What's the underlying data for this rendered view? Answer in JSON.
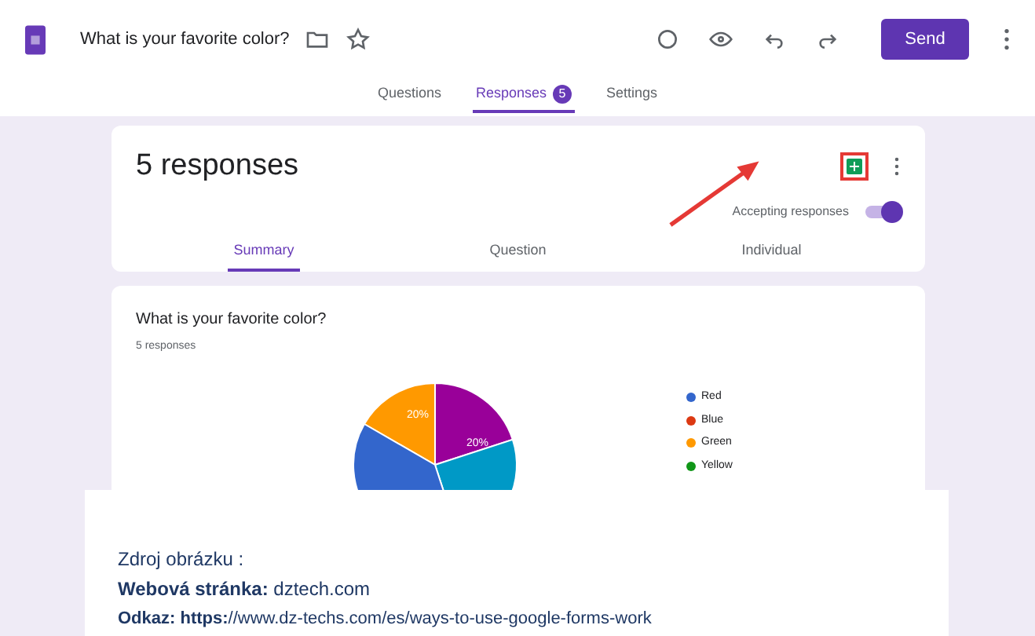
{
  "window": {
    "title": "What is your favorite color?"
  },
  "toolbar": {
    "send_label": "Send"
  },
  "tabs": [
    {
      "label": "Questions",
      "selected": false
    },
    {
      "label": "Responses",
      "selected": true,
      "badge": "5"
    },
    {
      "label": "Settings",
      "selected": false
    }
  ],
  "summary_card": {
    "title": "5 responses",
    "accepting_label": "Accepting responses",
    "accepting": true,
    "highlight_sheets": true,
    "views": [
      {
        "label": "Summary",
        "selected": true
      },
      {
        "label": "Question",
        "selected": false
      },
      {
        "label": "Individual",
        "selected": false
      }
    ]
  },
  "question_card": {
    "title": "What is your favorite color?",
    "count": "5 responses",
    "slice_labels": [
      "20%",
      "20%"
    ],
    "legend": [
      {
        "label": "Red",
        "color": "#3366cc"
      },
      {
        "label": "Blue",
        "color": "#dc3912"
      },
      {
        "label": "Green",
        "color": "#ff9900"
      },
      {
        "label": "Yellow",
        "color": "#109618"
      }
    ]
  },
  "source_note": {
    "heading": "Zdroj obrázku :",
    "website": "**Webová stránka:** dztech.com",
    "link": "**Odkaz: https:**//www.dz-techs.com/es/ways-to-use-google-forms-work"
  }
}
